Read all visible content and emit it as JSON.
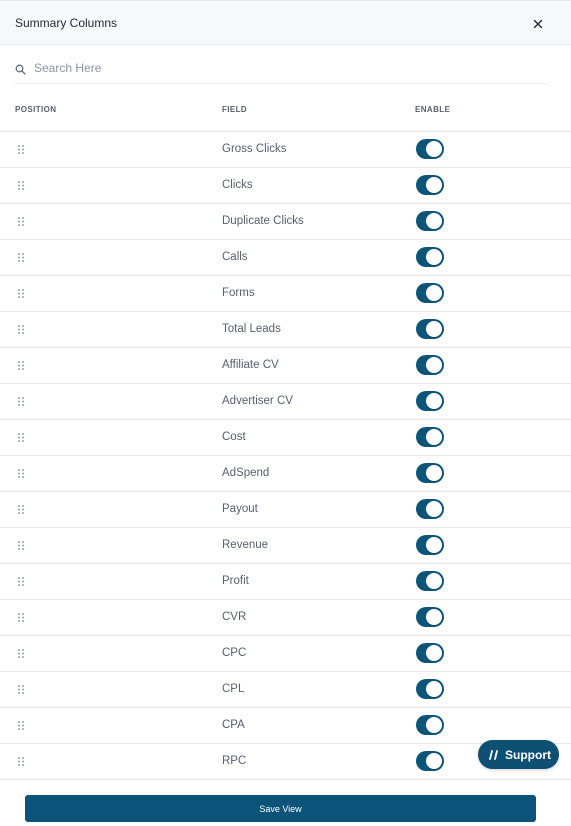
{
  "dialog": {
    "title": "Summary Columns",
    "close_icon": "close-icon"
  },
  "search": {
    "placeholder": "Search Here",
    "value": "",
    "icon": "search-icon"
  },
  "table": {
    "headers": {
      "position": "POSITION",
      "field": "FIELD",
      "enable": "ENABLE"
    },
    "rows": [
      {
        "field": "Gross Clicks",
        "enabled": true
      },
      {
        "field": "Clicks",
        "enabled": true
      },
      {
        "field": "Duplicate Clicks",
        "enabled": true
      },
      {
        "field": "Calls",
        "enabled": true
      },
      {
        "field": "Forms",
        "enabled": true
      },
      {
        "field": "Total Leads",
        "enabled": true
      },
      {
        "field": "Affiliate CV",
        "enabled": true
      },
      {
        "field": "Advertiser CV",
        "enabled": true
      },
      {
        "field": "Cost",
        "enabled": true
      },
      {
        "field": "AdSpend",
        "enabled": true
      },
      {
        "field": "Payout",
        "enabled": true
      },
      {
        "field": "Revenue",
        "enabled": true
      },
      {
        "field": "Profit",
        "enabled": true
      },
      {
        "field": "CVR",
        "enabled": true
      },
      {
        "field": "CPC",
        "enabled": true
      },
      {
        "field": "CPL",
        "enabled": true
      },
      {
        "field": "CPA",
        "enabled": true
      },
      {
        "field": "RPC",
        "enabled": true
      }
    ]
  },
  "footer": {
    "save_label": "Save View"
  },
  "support": {
    "label": "Support",
    "icon": "support-icon"
  },
  "colors": {
    "toggle_on": "#0c5579",
    "primary_button": "#0b5378",
    "support_button": "#0e4f74",
    "header_bg": "#f6f8fb"
  }
}
